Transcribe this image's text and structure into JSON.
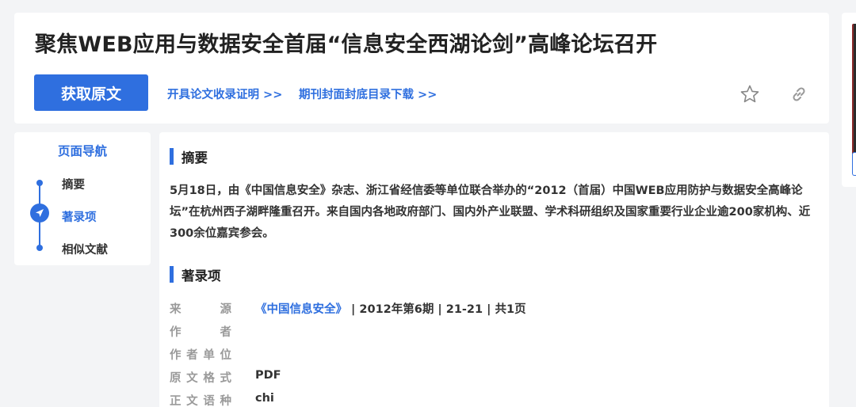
{
  "header": {
    "title": "聚焦WEB应用与数据安全首届“信息安全西湖论剑”高峰论坛召开",
    "get_fulltext_label": "获取原文",
    "link_certificate": "开具论文收录证明 >>",
    "link_cover_download": "期刊封面封底目录下载 >>",
    "favorite_icon": "star-icon",
    "copy_link_icon": "link-icon"
  },
  "nav": {
    "title": "页面导航",
    "items": [
      {
        "label": "摘要"
      },
      {
        "label": "著录项"
      },
      {
        "label": "相似文献"
      }
    ],
    "active_icon": "navigation-arrow-icon"
  },
  "abstract": {
    "heading": "摘要",
    "text": "5月18日，由《中国信息安全》杂志、浙江省经信委等单位联合举办的“2012（首届）中国WEB应用防护与数据安全高峰论坛”在杭州西子湖畔隆重召开。来自国内各地政府部门、国内外产业联盟、学术科研组织及国家重要行业企业逾200家机构、近300余位嘉宾参会。"
  },
  "record": {
    "heading": "著录项",
    "rows": [
      {
        "label": [
          "来",
          "源"
        ],
        "journal": "《中国信息安全》",
        "value": " | 2012年第6期 | 21-21 | 共1页"
      },
      {
        "label": [
          "作",
          "者"
        ],
        "value": ""
      },
      {
        "label": [
          "作",
          "者",
          "单",
          "位"
        ],
        "value": ""
      },
      {
        "label": [
          "原",
          "文",
          "格",
          "式"
        ],
        "value": "PDF"
      },
      {
        "label": [
          "正",
          "文",
          "语",
          "种"
        ],
        "value": "chi"
      }
    ]
  },
  "colors": {
    "accent": "#2f6fdf",
    "background": "#f3f4f6",
    "label_gray": "#9a9a9a"
  }
}
